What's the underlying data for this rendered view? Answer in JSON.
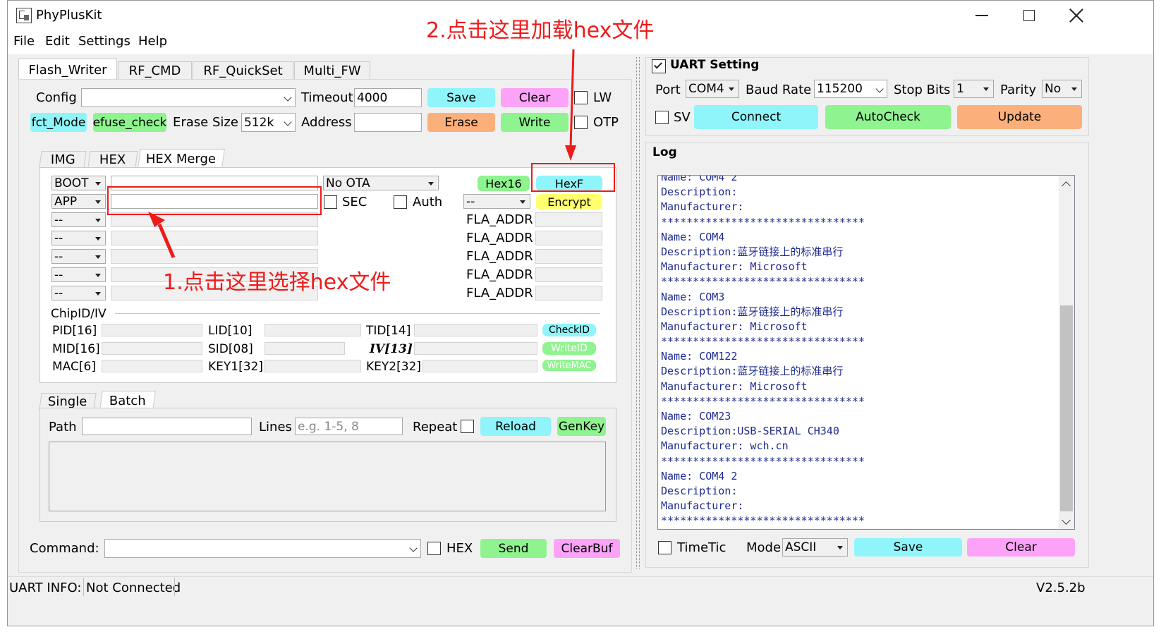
{
  "app": {
    "title": "PhyPlusKit",
    "version": "V2.5.2b"
  },
  "menu": [
    "File",
    "Edit",
    "Settings",
    "Help"
  ],
  "tabs": [
    "Flash_Writer",
    "RF_CMD",
    "RF_QuickSet",
    "Multi_FW"
  ],
  "config": {
    "config_label": "Config",
    "config_value": "",
    "timeout_label": "Timeout",
    "timeout_value": "4000",
    "save": "Save",
    "clear": "Clear",
    "lw": "LW",
    "fct_mode": "fct_Mode",
    "efuse_check": "efuse_check",
    "erase_size_label": "Erase Size",
    "erase_size_value": "512k",
    "address_label": "Address",
    "address_value": "",
    "erase": "Erase",
    "write": "Write",
    "otp": "OTP"
  },
  "subtabs": [
    "IMG",
    "HEX",
    "HEX Merge"
  ],
  "hexmerge": {
    "boot": "BOOT",
    "app": "APP",
    "none": "--",
    "no_ota": "No OTA",
    "sec": "SEC",
    "auth": "Auth",
    "hex16": "Hex16",
    "hexf": "HexF",
    "encrypt": "Encrypt",
    "fla_addr": "FLA_ADDR"
  },
  "chipid": {
    "title": "ChipID/IV",
    "pid": "PID[16]",
    "lid": "LID[10]",
    "tid": "TID[14]",
    "checkid": "CheckID",
    "mid": "MID[16]",
    "sid": "SID[08]",
    "iv": "IV[13]",
    "writeid": "WriteID",
    "mac": "MAC[6]",
    "key1": "KEY1[32]",
    "key2": "KEY2[32]",
    "writemac": "WriteMAC"
  },
  "batch_tabs": [
    "Single",
    "Batch"
  ],
  "batch": {
    "path_label": "Path",
    "lines_label": "Lines",
    "lines_placeholder": "e.g. 1-5, 8",
    "repeat": "Repeat",
    "reload": "Reload",
    "genkey": "GenKey"
  },
  "command": {
    "label": "Command:",
    "hex": "HEX",
    "send": "Send",
    "clearbuf": "ClearBuf"
  },
  "uart": {
    "title": "UART Setting",
    "port_label": "Port",
    "port_value": "COM4",
    "baud_label": "Baud Rate",
    "baud_value": "115200",
    "stop_label": "Stop Bits",
    "stop_value": "1",
    "parity_label": "Parity",
    "parity_value": "No",
    "sv": "SV",
    "connect": "Connect",
    "autocheck": "AutoCheck",
    "update": "Update"
  },
  "log": {
    "title": "Log",
    "lines": [
      "Name: COM4 2",
      "Description:",
      "Manufacturer:",
      "********************************",
      "Name: COM4",
      "Description:蓝牙链接上的标准串行",
      "Manufacturer: Microsoft",
      "********************************",
      "Name: COM3",
      "Description:蓝牙链接上的标准串行",
      "Manufacturer: Microsoft",
      "********************************",
      "Name: COM122",
      "Description:蓝牙链接上的标准串行",
      "Manufacturer: Microsoft",
      "********************************",
      "Name: COM23",
      "Description:USB-SERIAL CH340",
      "Manufacturer: wch.cn",
      "********************************",
      "Name: COM4 2",
      "Description:",
      "Manufacturer:",
      "********************************"
    ],
    "timetic": "TimeTic",
    "mode_label": "Mode",
    "mode_value": "ASCII",
    "save": "Save",
    "clear": "Clear"
  },
  "status": {
    "label": "UART INFO:",
    "value": "Not Connected"
  },
  "annotations": {
    "step1": "1.点击这里选择hex文件",
    "step2": "2.点击这里加载hex文件",
    "color": "#ee1b1b"
  }
}
